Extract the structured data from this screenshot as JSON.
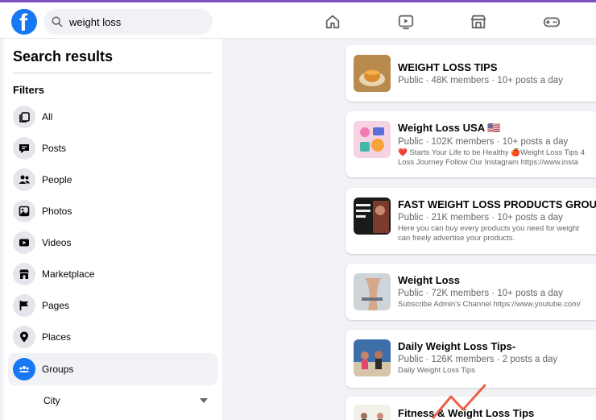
{
  "topbar": {
    "logo_letter": "f",
    "search_value": "weight loss",
    "nav_icons": [
      "home-icon",
      "watch-icon",
      "marketplace-icon",
      "gaming-icon"
    ]
  },
  "sidebar": {
    "title": "Search results",
    "filters_label": "Filters",
    "items": [
      {
        "label": "All",
        "icon": "all-icon"
      },
      {
        "label": "Posts",
        "icon": "posts-icon"
      },
      {
        "label": "People",
        "icon": "people-icon"
      },
      {
        "label": "Photos",
        "icon": "photos-icon"
      },
      {
        "label": "Videos",
        "icon": "videos-icon"
      },
      {
        "label": "Marketplace",
        "icon": "marketplace-icon"
      },
      {
        "label": "Pages",
        "icon": "pages-icon"
      },
      {
        "label": "Places",
        "icon": "places-icon"
      },
      {
        "label": "Groups",
        "icon": "groups-icon",
        "active": true
      }
    ],
    "city_label": "City"
  },
  "results": [
    {
      "title": "WEIGHT LOSS TIPS",
      "meta": "Public · 48K members · 10+ posts a day",
      "desc": []
    },
    {
      "title": "Weight Loss USA 🇺🇸",
      "meta": "Public · 102K members · 10+ posts a day",
      "desc": [
        "❤️ Starts Your Life to be Healthy 🍎Weight Loss Tips 4",
        "Loss Journey Follow Our Instagram https://www.insta"
      ]
    },
    {
      "title": "FAST WEIGHT LOSS PRODUCTS GROUP",
      "meta": "Public · 21K members · 10+ posts a day",
      "desc": [
        "Here you can buy every products you need for weight",
        "can freely advertise your products."
      ]
    },
    {
      "title": "Weight Loss",
      "meta": "Public · 72K members · 10+ posts a day",
      "desc": [
        "Subscribe Admin's Channel https://www.youtube.com/"
      ]
    },
    {
      "title": "Daily Weight Loss Tips-",
      "meta": "Public · 126K members · 2 posts a day",
      "desc": [
        "Daily Weight Loss Tips"
      ]
    },
    {
      "title": "Fitness & Weight Loss Tips",
      "meta": "",
      "desc": []
    }
  ],
  "colors": {
    "accent": "#1877f2",
    "top_border": "#7b4fbf",
    "watermark": "#e8452c"
  }
}
